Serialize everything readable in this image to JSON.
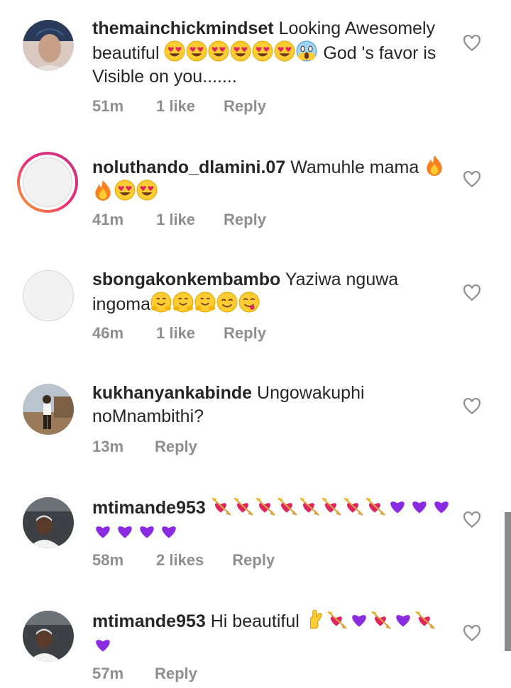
{
  "comments": [
    {
      "username": "themainchickmindset",
      "text_before": "Looking Awesomely beautiful ",
      "emojis_1": [
        "heart-eyes",
        "heart-eyes",
        "heart-eyes",
        "heart-eyes",
        "heart-eyes",
        "heart-eyes",
        "scream"
      ],
      "text_after": " God 's favor is Visible on you.......",
      "time": "51m",
      "likes": "1 like",
      "reply": "Reply",
      "avatar": "photo-woman"
    },
    {
      "username": "noluthando_dlamini.07",
      "text_before": "Wamuhle mama",
      "emojis_1": [
        "fire",
        "fire",
        "heart-eyes",
        "heart-eyes"
      ],
      "text_after": "",
      "time": "41m",
      "likes": "1 like",
      "reply": "Reply",
      "avatar": "story-ring-default"
    },
    {
      "username": "sbongakonkembambo",
      "text_before": "Yaziwa nguwa ingoma",
      "emojis_1": [
        "hugging",
        "hugging",
        "hugging",
        "smile",
        "yum"
      ],
      "text_after": "",
      "time": "46m",
      "likes": "1 like",
      "reply": "Reply",
      "avatar": "default"
    },
    {
      "username": "kukhanyankabinde",
      "text_before": "Ungowakuphi noMnambithi?",
      "emojis_1": [],
      "text_after": "",
      "time": "13m",
      "likes": "",
      "reply": "Reply",
      "avatar": "photo-outdoor"
    },
    {
      "username": "mtimande953",
      "text_before": "",
      "emojis_1": [
        "heart-arrow",
        "heart-arrow",
        "heart-arrow",
        "heart-arrow",
        "heart-arrow",
        "heart-arrow",
        "heart-arrow",
        "heart-arrow",
        "purple-heart",
        "purple-heart",
        "purple-heart",
        "purple-heart",
        "purple-heart",
        "purple-heart",
        "purple-heart"
      ],
      "text_after": "",
      "time": "58m",
      "likes": "2 likes",
      "reply": "Reply",
      "avatar": "photo-car-man"
    },
    {
      "username": "mtimande953",
      "text_before": "Hi beautiful ",
      "emojis_1": [
        "crossed-fingers",
        "heart-arrow",
        "purple-heart",
        "heart-arrow",
        "purple-heart",
        "heart-arrow",
        "purple-heart"
      ],
      "text_after": "",
      "time": "57m",
      "likes": "",
      "reply": "Reply",
      "avatar": "photo-car-man"
    }
  ],
  "colors": {
    "text": "#262626",
    "meta": "#8e8e8e",
    "heart_stroke": "#8e8e8e"
  },
  "icons": {
    "like": "heart-outline-icon"
  }
}
